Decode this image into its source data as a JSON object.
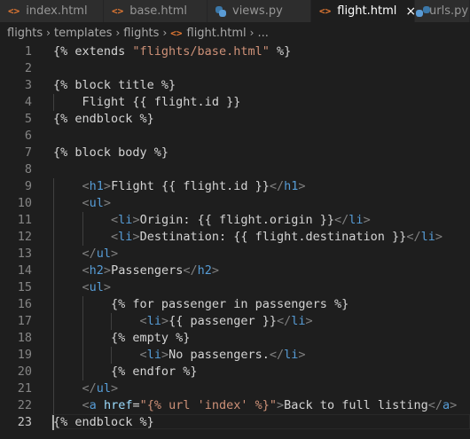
{
  "tabs": [
    {
      "label": "index.html",
      "icon": "html-icon",
      "active": false
    },
    {
      "label": "base.html",
      "icon": "html-icon",
      "active": false
    },
    {
      "label": "views.py",
      "icon": "python-icon",
      "active": false
    },
    {
      "label": "flight.html",
      "icon": "html-icon",
      "active": true,
      "close": "×"
    },
    {
      "label": "urls.py",
      "icon": "python-icon",
      "active": false
    }
  ],
  "icons": {
    "html_glyph": "<>",
    "chevron": "›"
  },
  "breadcrumb": {
    "items": [
      "flights",
      "templates",
      "flights",
      "flight.html",
      "..."
    ]
  },
  "colors": {
    "background": "#1e1e1e",
    "tag": "#569cd6",
    "string": "#ce9178",
    "attribute": "#9cdcfe",
    "bracket": "#808080",
    "html_icon": "#e37933"
  },
  "editor": {
    "current_line": 23,
    "lines": [
      {
        "n": "1",
        "indent": 0,
        "tokens": [
          [
            "tmpl",
            "{% extends "
          ],
          [
            "str",
            "\"flights/base.html\""
          ],
          [
            "tmpl",
            " %}"
          ]
        ]
      },
      {
        "n": "2",
        "indent": 0,
        "tokens": []
      },
      {
        "n": "3",
        "indent": 0,
        "tokens": [
          [
            "tmpl",
            "{% block title %}"
          ]
        ]
      },
      {
        "n": "4",
        "indent": 1,
        "tokens": [
          [
            "txt",
            "Flight {{ flight.id }}"
          ]
        ]
      },
      {
        "n": "5",
        "indent": 0,
        "tokens": [
          [
            "tmpl",
            "{% endblock %}"
          ]
        ]
      },
      {
        "n": "6",
        "indent": 0,
        "tokens": []
      },
      {
        "n": "7",
        "indent": 0,
        "tokens": [
          [
            "tmpl",
            "{% block body %}"
          ]
        ]
      },
      {
        "n": "8",
        "indent": 0,
        "tokens": []
      },
      {
        "n": "9",
        "indent": 1,
        "tokens": [
          [
            "br",
            "<"
          ],
          [
            "tag",
            "h1"
          ],
          [
            "br",
            ">"
          ],
          [
            "txt",
            "Flight {{ flight.id }}"
          ],
          [
            "br",
            "</"
          ],
          [
            "tag",
            "h1"
          ],
          [
            "br",
            ">"
          ]
        ]
      },
      {
        "n": "10",
        "indent": 1,
        "tokens": [
          [
            "br",
            "<"
          ],
          [
            "tag",
            "ul"
          ],
          [
            "br",
            ">"
          ]
        ]
      },
      {
        "n": "11",
        "indent": 2,
        "tokens": [
          [
            "br",
            "<"
          ],
          [
            "tag",
            "li"
          ],
          [
            "br",
            ">"
          ],
          [
            "txt",
            "Origin: {{ flight.origin }}"
          ],
          [
            "br",
            "</"
          ],
          [
            "tag",
            "li"
          ],
          [
            "br",
            ">"
          ]
        ]
      },
      {
        "n": "12",
        "indent": 2,
        "tokens": [
          [
            "br",
            "<"
          ],
          [
            "tag",
            "li"
          ],
          [
            "br",
            ">"
          ],
          [
            "txt",
            "Destination: {{ flight.destination }}"
          ],
          [
            "br",
            "</"
          ],
          [
            "tag",
            "li"
          ],
          [
            "br",
            ">"
          ]
        ]
      },
      {
        "n": "13",
        "indent": 1,
        "tokens": [
          [
            "br",
            "</"
          ],
          [
            "tag",
            "ul"
          ],
          [
            "br",
            ">"
          ]
        ]
      },
      {
        "n": "14",
        "indent": 1,
        "tokens": [
          [
            "br",
            "<"
          ],
          [
            "tag",
            "h2"
          ],
          [
            "br",
            ">"
          ],
          [
            "txt",
            "Passengers"
          ],
          [
            "br",
            "</"
          ],
          [
            "tag",
            "h2"
          ],
          [
            "br",
            ">"
          ]
        ]
      },
      {
        "n": "15",
        "indent": 1,
        "tokens": [
          [
            "br",
            "<"
          ],
          [
            "tag",
            "ul"
          ],
          [
            "br",
            ">"
          ]
        ]
      },
      {
        "n": "16",
        "indent": 2,
        "tokens": [
          [
            "tmpl",
            "{% for passenger in passengers %}"
          ]
        ]
      },
      {
        "n": "17",
        "indent": 3,
        "tokens": [
          [
            "br",
            "<"
          ],
          [
            "tag",
            "li"
          ],
          [
            "br",
            ">"
          ],
          [
            "txt",
            "{{ passenger }}"
          ],
          [
            "br",
            "</"
          ],
          [
            "tag",
            "li"
          ],
          [
            "br",
            ">"
          ]
        ]
      },
      {
        "n": "18",
        "indent": 2,
        "tokens": [
          [
            "tmpl",
            "{% empty %}"
          ]
        ]
      },
      {
        "n": "19",
        "indent": 3,
        "tokens": [
          [
            "br",
            "<"
          ],
          [
            "tag",
            "li"
          ],
          [
            "br",
            ">"
          ],
          [
            "txt",
            "No passengers."
          ],
          [
            "br",
            "</"
          ],
          [
            "tag",
            "li"
          ],
          [
            "br",
            ">"
          ]
        ]
      },
      {
        "n": "20",
        "indent": 2,
        "tokens": [
          [
            "tmpl",
            "{% endfor %}"
          ]
        ]
      },
      {
        "n": "21",
        "indent": 1,
        "tokens": [
          [
            "br",
            "</"
          ],
          [
            "tag",
            "ul"
          ],
          [
            "br",
            ">"
          ]
        ]
      },
      {
        "n": "22",
        "indent": 1,
        "tokens": [
          [
            "br",
            "<"
          ],
          [
            "tag",
            "a"
          ],
          [
            "txt",
            " "
          ],
          [
            "attr",
            "href"
          ],
          [
            "eq",
            "="
          ],
          [
            "str",
            "\"{% url 'index' %}\""
          ],
          [
            "br",
            ">"
          ],
          [
            "txt",
            "Back to full listing"
          ],
          [
            "br",
            "</"
          ],
          [
            "tag",
            "a"
          ],
          [
            "br",
            ">"
          ]
        ]
      },
      {
        "n": "23",
        "indent": 0,
        "tokens": [
          [
            "tmpl",
            "{% endblock %}"
          ]
        ]
      }
    ]
  }
}
